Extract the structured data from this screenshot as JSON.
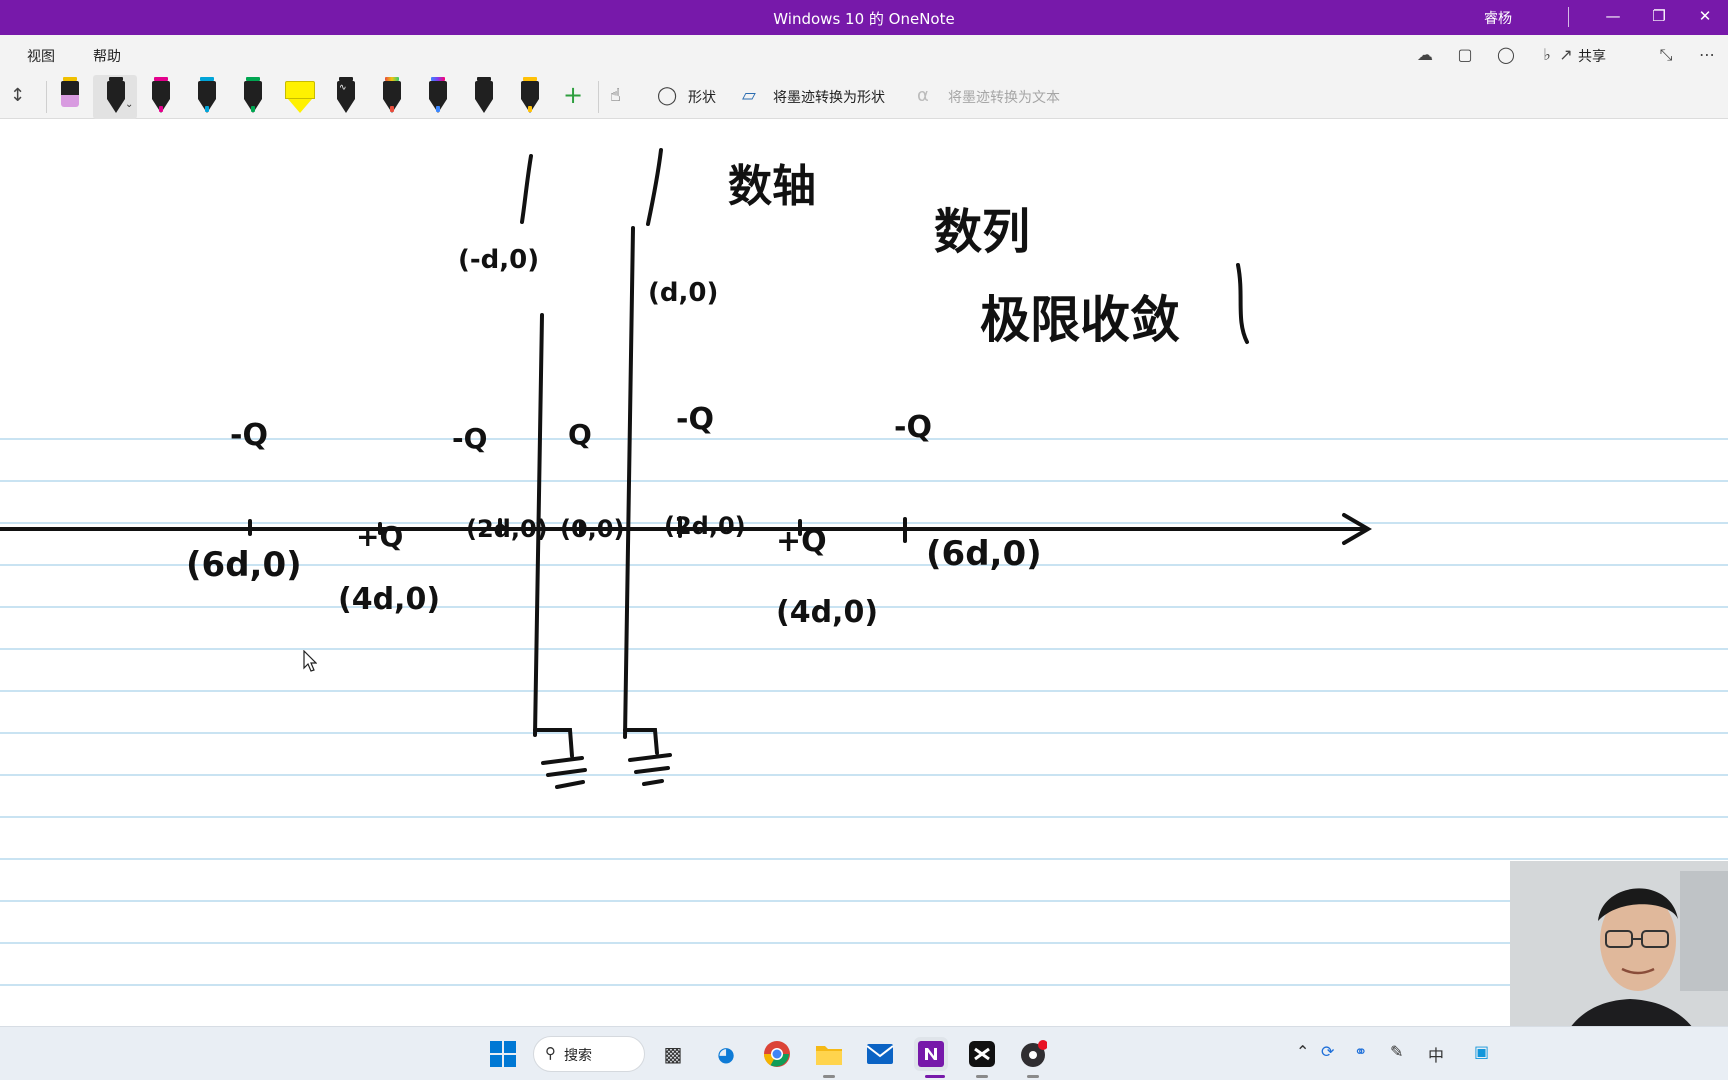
{
  "window": {
    "title": "Windows 10 的 OneNote",
    "user": "睿杨",
    "minimize_icon": "minimize-icon",
    "restore_icon": "restore-icon",
    "close_icon": "close-icon"
  },
  "menu": {
    "items": [
      "视图",
      "帮助"
    ],
    "share_label": "共享",
    "right_icons": [
      "sync-status-icon",
      "page-view-icon",
      "lightbulb-icon",
      "bell-icon",
      "share-icon",
      "fullscreen-icon",
      "more-icon"
    ]
  },
  "toolbar": {
    "pens": [
      {
        "name": "eraser",
        "color": "#d89be0"
      },
      {
        "name": "black-pen",
        "color": "#202020"
      },
      {
        "name": "magenta-pen",
        "color": "#e3008c"
      },
      {
        "name": "cyan-pen",
        "color": "#00a4d8"
      },
      {
        "name": "green-pen",
        "color": "#00a651"
      },
      {
        "name": "yellow-highlighter",
        "color": "#fff100"
      },
      {
        "name": "zigzag-pen",
        "color": "#202020"
      },
      {
        "name": "rainbow-pen-1",
        "color": "#e74c3c"
      },
      {
        "name": "rainbow-pen-2",
        "color": "#3a86ff"
      },
      {
        "name": "black-pen-2",
        "color": "#202020"
      },
      {
        "name": "yellow-pen",
        "color": "#ffc107"
      }
    ],
    "add_pen": "+",
    "shapes_label": "形状",
    "ink_to_shape_label": "将墨迹转换为形状",
    "ink_to_text_label": "将墨迹转换为文本"
  },
  "canvas": {
    "ink_labels": {
      "axis_note": "数轴",
      "sequence_note": "数列",
      "limit_note": "极限收敛",
      "wire_left_coord": "(-d,0)",
      "wire_right_coord": "(d,0)",
      "charge_far_left": "-Q",
      "charge_left": "-Q",
      "charge_center": "Q",
      "charge_right": "-Q",
      "charge_far_right": "-Q",
      "coord_far_left": "(6d,0)",
      "charge_plus_left": "+Q",
      "coord_plus_left": "(4d,0)",
      "coord_left": "(2d,0)",
      "coord_origin": "(0,0)",
      "coord_right": "(2d,0)",
      "charge_plus_right": "+Q",
      "coord_plus_right": "(4d,0)",
      "coord_far_right": "(6d,0)"
    }
  },
  "taskbar": {
    "search_label": "搜索",
    "apps": [
      "start-icon",
      "search",
      "task-view-icon",
      "edge-icon",
      "chrome-icon",
      "file-explorer-icon",
      "mail-icon",
      "onenote-icon",
      "capcut-icon",
      "obs-icon"
    ],
    "tray_icons": [
      "chevron-up-icon",
      "sync-icon",
      "microphone-icon",
      "pen-icon",
      "ime-icon",
      "qq-icon"
    ],
    "ime_label": "中"
  }
}
